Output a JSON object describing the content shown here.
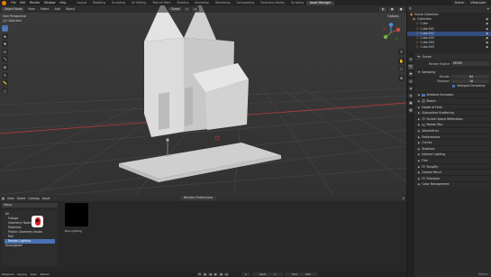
{
  "topbar": {
    "menus": [
      "File",
      "Edit",
      "Render",
      "Window",
      "Help"
    ],
    "workspaces": [
      "Layout",
      "Modeling",
      "Sculpting",
      "UV Editing",
      "Texture Paint",
      "Shading",
      "Animation",
      "Rendering",
      "Compositing",
      "Geometry Nodes",
      "Scripting",
      "Asset Manager"
    ],
    "active_workspace": "Asset Manager",
    "scene": "Scene",
    "view_layer": "ViewLayer"
  },
  "viewport": {
    "mode": "Object Mode",
    "menus": [
      "View",
      "Select",
      "Add",
      "Object"
    ],
    "transform": "Global",
    "options": "Options",
    "info_line1": "User Perspective",
    "info_line2": "(1) Collection",
    "colors": {
      "background": "#3a3a3a",
      "grid": "#4a4a4a",
      "x_axis": "#b83b3b",
      "model": "#d9d9d9"
    }
  },
  "asset_browser": {
    "menus": [
      "View",
      "Select",
      "Catalog",
      "Asset"
    ],
    "library_select": "Setup",
    "center_field": "Blender Preferences",
    "categories": [
      {
        "label": "All",
        "selected": false
      },
      {
        "label": "Foliage",
        "selected": false
      },
      {
        "label": "Geometry Nodes",
        "selected": false
      },
      {
        "label": "Materials",
        "selected": false
      },
      {
        "label": "Plastic Geometry Nodes",
        "selected": false
      },
      {
        "label": "Rail",
        "selected": false
      },
      {
        "label": "Render Lighting",
        "selected": true
      },
      {
        "label": "Unassigned",
        "selected": false
      }
    ],
    "asset_name": "Box Lighting"
  },
  "timeline": {
    "labels": [
      "Playback",
      "Keying",
      "View",
      "Marker"
    ],
    "current_frame": "1",
    "start_label": "Start",
    "start": "1",
    "end_label": "End",
    "end": "250",
    "status_left": "Select",
    "status_mid": "Center View",
    "status_right": "Collection | Cube | Verts:8 | Faces:6 | Tris:12 | Objects:1/1 | Memory: 31.4 MiB | 3.0.0"
  },
  "outliner": {
    "title": "Scene Collection",
    "items": [
      {
        "label": "Collection",
        "depth": 0,
        "selected": false
      },
      {
        "label": "Cube",
        "depth": 1,
        "selected": false
      },
      {
        "label": "Cube.001",
        "depth": 1,
        "selected": false
      },
      {
        "label": "Cube.002",
        "depth": 1,
        "selected": true
      },
      {
        "label": "Cube.003",
        "depth": 1,
        "selected": false
      },
      {
        "label": "Cube.004",
        "depth": 1,
        "selected": false
      },
      {
        "label": "Cube.005",
        "depth": 1,
        "selected": false
      },
      {
        "label": "Cube.006",
        "depth": 1,
        "selected": false
      }
    ]
  },
  "properties": {
    "scene_label": "Scene",
    "render_engine_label": "Render Engine",
    "render_engine": "EEVEE",
    "sampling": "Sampling",
    "render_label": "Render",
    "render_value": "64",
    "viewport_label": "Viewport",
    "viewport_value": "16",
    "viewport_denoising": "Viewport Denoising",
    "panels": [
      "Ambient Occlusion",
      "Bloom",
      "Depth of Field",
      "Subsurface Scattering",
      "Screen Space Reflections",
      "Motion Blur",
      "Volumetrics",
      "Performance",
      "Curves",
      "Shadows",
      "Indirect Lighting",
      "Film",
      "Simplify",
      "Grease Pencil",
      "Freestyle",
      "Color Management"
    ]
  },
  "watermark": "Udemy"
}
